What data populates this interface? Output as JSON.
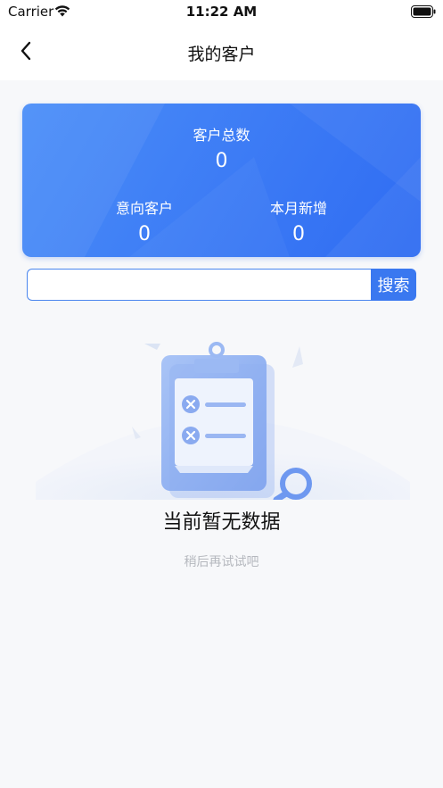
{
  "status_bar": {
    "carrier": "Carrier",
    "time": "11:22 AM"
  },
  "nav": {
    "title": "我的客户"
  },
  "summary": {
    "total_label": "客户总数",
    "total_value": "0",
    "intent_label": "意向客户",
    "intent_value": "0",
    "monthly_label": "本月新增",
    "monthly_value": "0"
  },
  "search": {
    "value": "",
    "button_label": "搜索"
  },
  "empty_state": {
    "title": "当前暂无数据",
    "subtitle": "稍后再试试吧"
  },
  "colors": {
    "accent": "#3a78f0",
    "card_start": "#4a8ef8",
    "card_end": "#2f6cf2",
    "subtitle_gray": "#b5b8be"
  }
}
